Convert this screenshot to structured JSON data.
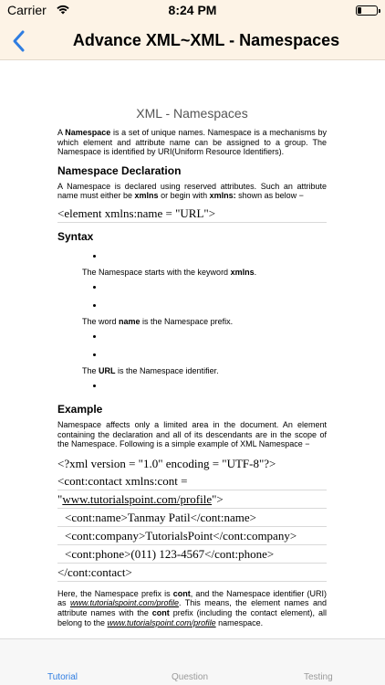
{
  "status": {
    "carrier": "Carrier",
    "time": "8:24 PM"
  },
  "nav": {
    "back_icon": "chevron-left-icon",
    "title": "Advance XML~XML - Namespaces"
  },
  "article": {
    "doc_title": "XML - Namespaces",
    "intro": [
      "A ",
      "Namespace",
      " is a set of unique names. Namespace is a mechanisms by which element and attribute name can be assigned to a group. The Namespace is identified by URI(Uniform Resource Identifiers)."
    ],
    "h_declaration": "Namespace Declaration",
    "decl_para": [
      "A Namespace is declared using reserved attributes. Such an attribute name must either be ",
      "xmlns",
      " or begin with ",
      "xmlns:",
      " shown as below −"
    ],
    "decl_code": "<element xmlns:name = \"URL\">",
    "h_syntax": "Syntax",
    "syntax_items": [
      [
        "The Namespace starts with the keyword ",
        "xmlns",
        "."
      ],
      [
        "The word ",
        "name",
        " is the Namespace prefix."
      ],
      [
        "The ",
        "URL",
        " is the Namespace identifier."
      ]
    ],
    "h_example": "Example",
    "example_para": "Namespace affects only a limited area in the document. An element containing the declaration and all of its descendants are in the scope of the Namespace. Following is a simple example of XML Namespace −",
    "code_lines": {
      "l1": "<?xml version = \"1.0\" encoding = \"UTF-8\"?>",
      "l2": "<cont:contact xmlns:cont =",
      "l3_quote_open": "\"",
      "l3_link": "www.tutorialspoint.com/profile",
      "l3_close": "\">",
      "l4": "<cont:name>Tanmay Patil</cont:name>",
      "l5": "<cont:company>TutorialsPoint</cont:company>",
      "l6": "<cont:phone>(011) 123-4567</cont:phone>",
      "l7": "</cont:contact>"
    },
    "closing_para": {
      "p1": "Here, the Namespace prefix is ",
      "b1": "cont",
      "p2": ", and the Namespace identifier (URI) as ",
      "link1": "www.tutorialspoint.com/profile",
      "p3": ". This means, the element names and attribute names with the ",
      "b2": "cont",
      "p4": " prefix (including the contact element), all belong to the ",
      "link2": "www.tutorialspoint.com/profile",
      "p5": " namespace."
    }
  },
  "tabs": [
    {
      "label": "Tutorial",
      "active": true
    },
    {
      "label": "Question",
      "active": false
    },
    {
      "label": "Testing",
      "active": false
    }
  ],
  "colors": {
    "accent": "#2f7de1",
    "bar_bg": "#fdf3e6",
    "tab_inactive": "#9a9a9a"
  }
}
